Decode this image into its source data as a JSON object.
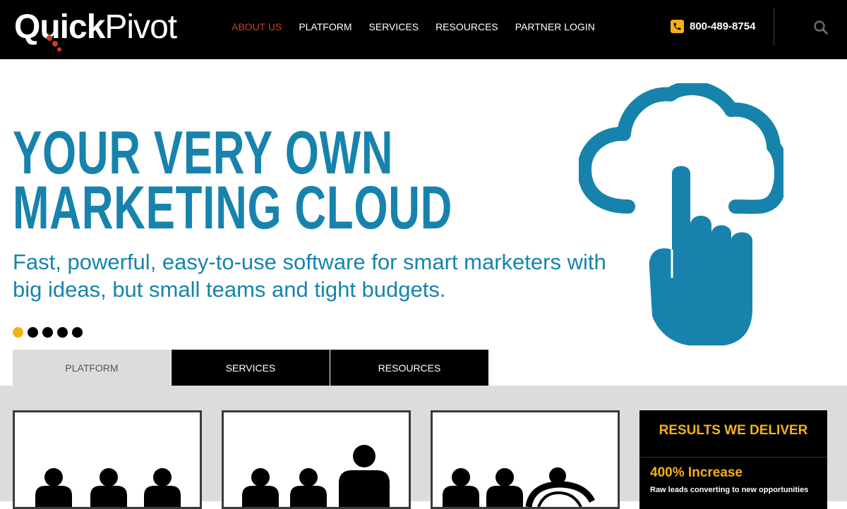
{
  "header": {
    "logo": {
      "quick": "Quick",
      "pivot": "Pivot"
    },
    "nav": [
      {
        "label": "ABOUT US",
        "active": true
      },
      {
        "label": "PLATFORM",
        "active": false
      },
      {
        "label": "SERVICES",
        "active": false
      },
      {
        "label": "RESOURCES",
        "active": false
      },
      {
        "label": "PARTNER LOGIN",
        "active": false
      }
    ],
    "phone": "800-489-8754"
  },
  "hero": {
    "title_line1": "YOUR VERY OWN",
    "title_line2": "MARKETING CLOUD",
    "subtitle": "Fast, powerful, easy-to-use software for smart marketers with big ideas, but small teams and tight budgets.",
    "slides": 5,
    "active_slide": 1
  },
  "tabs": [
    {
      "label": "PLATFORM",
      "style": "light"
    },
    {
      "label": "SERVICES",
      "style": "dark"
    },
    {
      "label": "RESOURCES",
      "style": "dark"
    }
  ],
  "results": {
    "title": "RESULTS WE DELIVER",
    "stat": "400% Increase",
    "desc": "Raw leads converting to new opportunities"
  },
  "colors": {
    "brand_blue": "#1783ad",
    "accent_yellow": "#f5b019",
    "nav_active": "#c9411e",
    "header_bg": "#000000"
  }
}
